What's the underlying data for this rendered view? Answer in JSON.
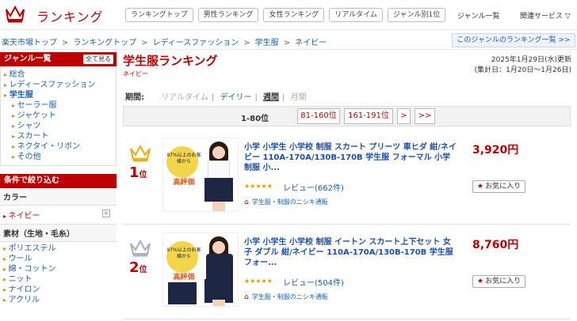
{
  "header": {
    "brand": "ランキング",
    "nav": [
      "ランキングトップ",
      "男性ランキング",
      "女性ランキング",
      "リアルタイム",
      "ジャンル別1位"
    ],
    "genre_list": "ジャンル一覧",
    "related": "関連サービス ▽"
  },
  "breadcrumb": {
    "items": [
      "楽天市場トップ",
      "ランキングトップ",
      "レディースファッション",
      "学生服",
      "ネイビー"
    ],
    "separator": ">",
    "genre_link": "このジャンルのランキング一覧 >>"
  },
  "sidebar": {
    "genre_title": "ジャンル一覧",
    "see_all": "全て見る",
    "items": [
      {
        "label": "総合"
      },
      {
        "label": "レディースファッション"
      },
      {
        "label": "学生服"
      },
      {
        "label": "セーラー服"
      },
      {
        "label": "ジャケット"
      },
      {
        "label": "シャツ"
      },
      {
        "label": "スカート"
      },
      {
        "label": "ネクタイ・リボン"
      },
      {
        "label": "その他"
      }
    ],
    "filter_title": "条件で絞り込む",
    "color_title": "カラー",
    "color_value": "ネイビー",
    "color_clear": "×",
    "material_title": "素材（生地・毛糸）",
    "materials": [
      "ポリエステル",
      "ウール",
      "綿・コットン",
      "ニット",
      "ナイロン",
      "アクリル"
    ]
  },
  "main": {
    "title": "学生服ランキング",
    "subtitle": "ネイビー",
    "updated": "2025年1月29日(水)更新",
    "period_note": "(集計日：1月20日〜1月26日)",
    "period_label": "期間:",
    "periods": {
      "realtime": "リアルタイム",
      "daily": "デイリー",
      "weekly": "週間",
      "monthly": "月間"
    },
    "pager": {
      "range": "1-80位",
      "p2": "81-160位",
      "p3": "161-191位",
      "next": ">",
      "last": ">>"
    }
  },
  "items": [
    {
      "rank": "1",
      "rank_unit": "位",
      "name": "小学 小学生 小学校 制服 スカート プリーツ 車ヒダ 紺/ネイビー 110A-170A/130B-170B 学生服 フォーマル 小学制服 小...",
      "stars": "★★★★★",
      "review": "レビュー(662件)",
      "shop": "学生服・制服のニシキ通販",
      "price": "3,920円",
      "fav": "お気に入り",
      "badge": "97%以上のお客様から",
      "badge2": "高評価",
      "crown_color": "#e8b21a"
    },
    {
      "rank": "2",
      "rank_unit": "位",
      "name": "小学 小学生 小学校 制服 イートン スカート上下セット 女子 ダブル 紺/ネイビー 110A-170A/130B-170B 学生服 フォー...",
      "stars": "★★★★★",
      "review": "レビュー(504件)",
      "shop": "学生服・制服のニシキ通販",
      "price": "8,760円",
      "fav": "お気に入り",
      "badge": "97%以上のお客様から",
      "badge2": "高評価",
      "crown_color": "#a9b4c2"
    }
  ]
}
